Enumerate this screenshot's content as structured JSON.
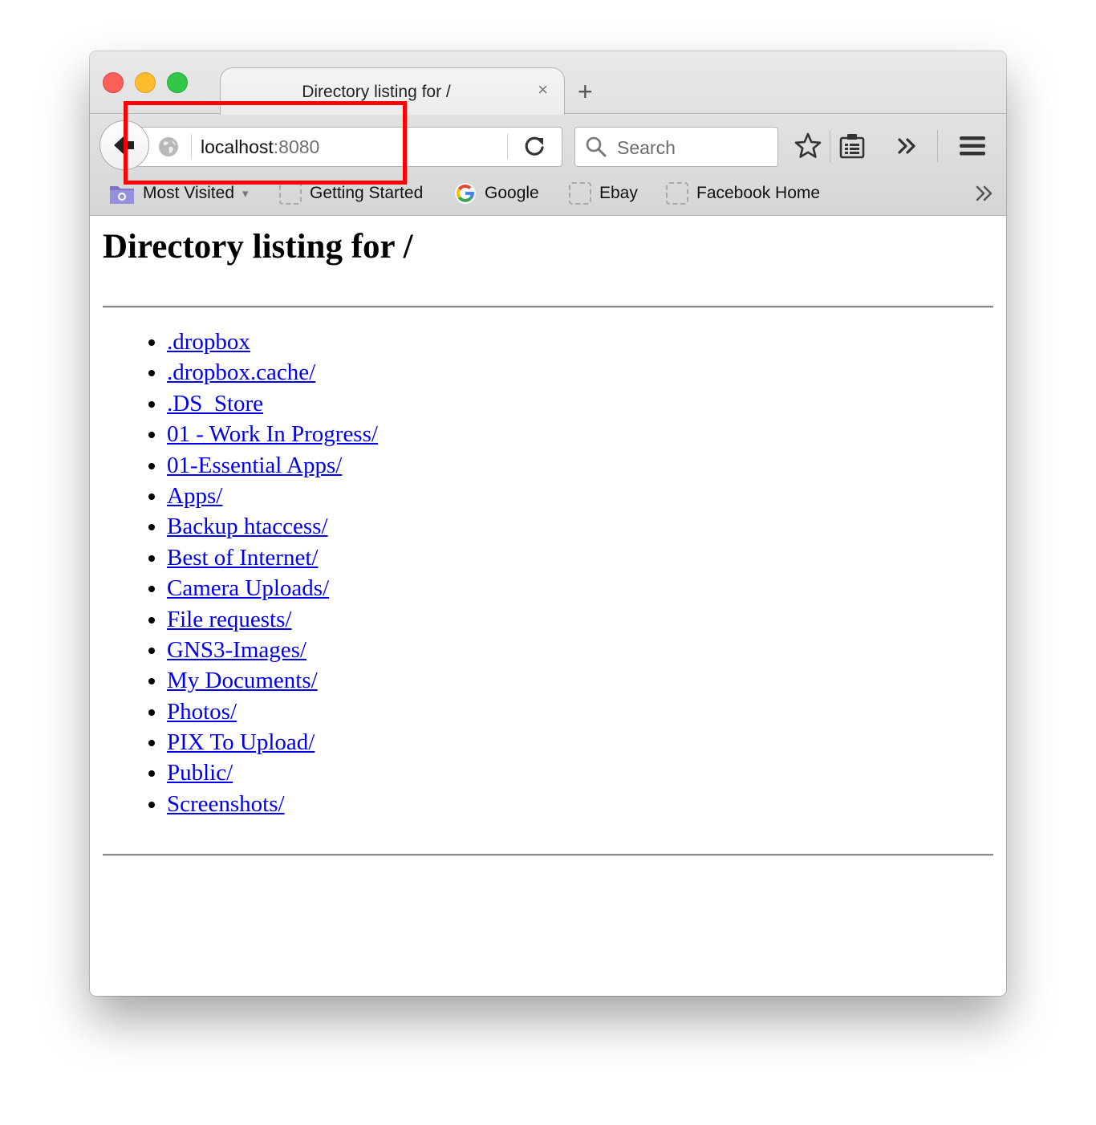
{
  "tab": {
    "title": "Directory listing for /",
    "close": "×",
    "new_tab": "+"
  },
  "urlbar": {
    "host": "localhost",
    "port": ":8080"
  },
  "search": {
    "placeholder": "Search"
  },
  "bookmarks": [
    {
      "label": "Most Visited",
      "icon": "folder-gear-icon",
      "dropdown": "▾"
    },
    {
      "label": "Getting Started",
      "icon": "bookmark-placeholder-icon"
    },
    {
      "label": "Google",
      "icon": "google-icon"
    },
    {
      "label": "Ebay",
      "icon": "bookmark-placeholder-icon"
    },
    {
      "label": "Facebook Home",
      "icon": "bookmark-placeholder-icon"
    }
  ],
  "page": {
    "heading": "Directory listing for /",
    "entries": [
      ".dropbox",
      ".dropbox.cache/",
      ".DS_Store",
      "01 - Work In Progress/",
      "01-Essential Apps/",
      "Apps/",
      "Backup htaccess/",
      "Best of Internet/",
      "Camera Uploads/",
      "File requests/",
      "GNS3-Images/",
      "My Documents/",
      "Photos/",
      "PIX To Upload/",
      "Public/",
      "Screenshots/"
    ]
  },
  "annotation": {
    "color": "#ff0000"
  }
}
